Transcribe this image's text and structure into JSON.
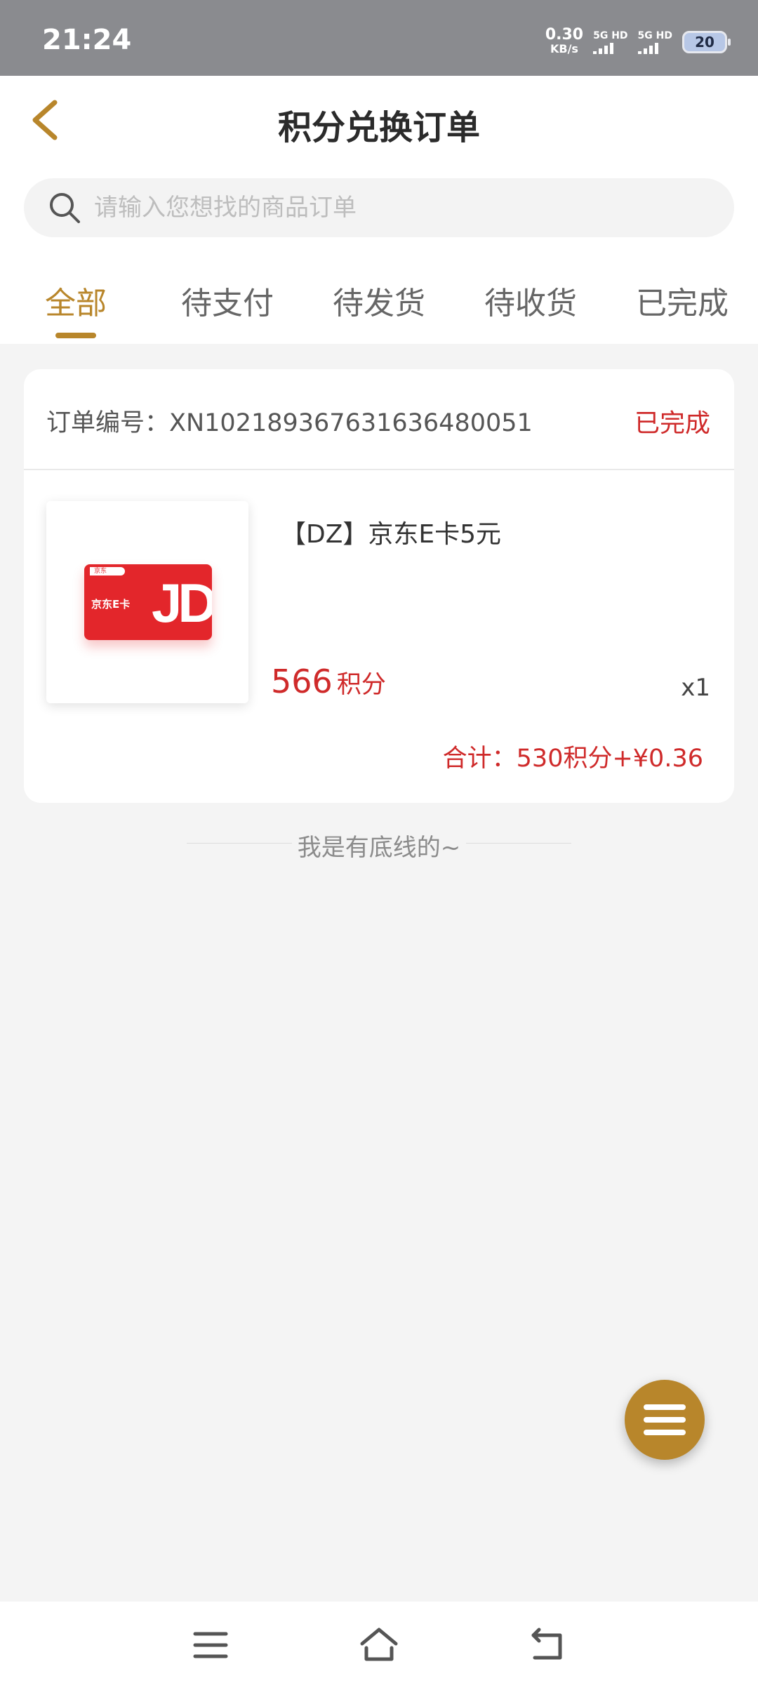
{
  "status_bar": {
    "time": "21:24",
    "net_speed_value": "0.30",
    "net_speed_unit": "KB/s",
    "sim1_label": "5G HD",
    "sim2_label": "5G HD",
    "battery": "20"
  },
  "header": {
    "back_icon": "chevron-left-icon",
    "title": "积分兑换订单"
  },
  "search": {
    "placeholder": "请输入您想找的商品订单",
    "value": ""
  },
  "tabs": [
    {
      "label": "全部",
      "active": true
    },
    {
      "label": "待支付",
      "active": false
    },
    {
      "label": "待发货",
      "active": false
    },
    {
      "label": "待收货",
      "active": false
    },
    {
      "label": "已完成",
      "active": false
    }
  ],
  "order": {
    "number_text": "订单编号：XN102189367631636480051",
    "status": "已完成",
    "product_name": "【DZ】京东E卡5元",
    "image_card_label": "京东E卡",
    "image_card_tag": "京东",
    "image_logo": "JD",
    "price_number": "566",
    "price_unit": "积分",
    "quantity": "x1",
    "total": "合计：530积分+¥0.36"
  },
  "footer_note": "我是有底线的~",
  "fab_icon": "menu-icon",
  "colors": {
    "accent": "#b8862b",
    "price_red": "#cf2a2a",
    "status_bar_bg": "#8a8b8f"
  },
  "nav_bar": {
    "icons": [
      "menu-icon",
      "home-icon",
      "back-icon"
    ]
  }
}
